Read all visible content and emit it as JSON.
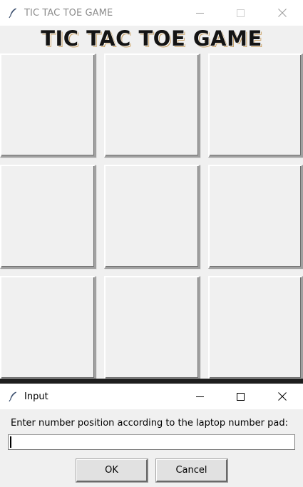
{
  "main_window": {
    "title": "TIC TAC TOE GAME",
    "heading": "TIC TAC TOE GAME",
    "icon": "feather-icon",
    "controls": {
      "minimize": "—",
      "maximize": "☐",
      "close": "✕"
    },
    "board": [
      [
        "",
        "",
        ""
      ],
      [
        "",
        "",
        ""
      ],
      [
        "",
        "",
        ""
      ]
    ]
  },
  "dialog": {
    "title": "Input",
    "icon": "feather-icon",
    "controls": {
      "minimize": "—",
      "maximize": "☐",
      "close": "✕"
    },
    "prompt": "Enter number position according to the laptop number pad:",
    "entry_value": "",
    "ok_label": "OK",
    "cancel_label": "Cancel"
  }
}
